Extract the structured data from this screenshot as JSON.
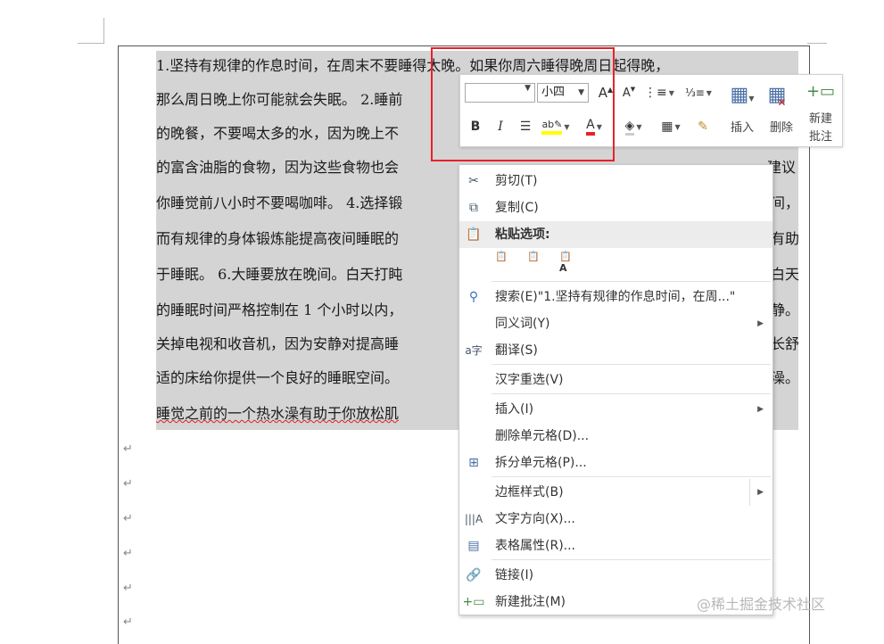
{
  "document": {
    "lines": [
      "1.坚持有规律的作息时间，在周末不要睡得太晚。如果你周六睡得晚周日起得晚，",
      "那么周日晚上你可能就会失眠。 2.睡前",
      "的晚餐，不要喝太多的水，因为晚上不",
      "的富含油脂的食物，因为这些食物也会",
      "你睡觉前八小时不要喝咖啡。 4.选择锻",
      "而有规律的身体锻炼能提高夜间睡眠的",
      "于睡眠。 6.大睡要放在晚间。白天打盹",
      "的睡眠时间严格控制在 1 个小时以内，",
      "关掉电视和收音机，因为安静对提高睡",
      "适的床给你提供一个良好的睡眠空间。",
      "睡觉之前的一个热水澡有助于你放松肌"
    ],
    "right_fragments": [
      "",
      "",
      "",
      "建议",
      "间，",
      "有助",
      "白天",
      "静。",
      "长舒",
      "澡。",
      ""
    ],
    "paragraph_mark": "↵"
  },
  "mini_toolbar": {
    "font_value": "",
    "size_value": "小四",
    "grow_font": "A",
    "shrink_font": "A",
    "bold": "B",
    "italic": "I",
    "font_color": "A",
    "insert_label": "插入",
    "delete_label": "删除",
    "comment_label_1": "新建",
    "comment_label_2": "批注"
  },
  "context_menu": {
    "cut": "剪切(T)",
    "copy": "复制(C)",
    "paste_header": "粘贴选项:",
    "search": "搜索(E)\"1.坚持有规律的作息时间，在周...\"",
    "synonyms": "同义词(Y)",
    "translate": "翻译(S)",
    "reconvert": "汉字重选(V)",
    "insert": "插入(I)",
    "delete_cells": "删除单元格(D)...",
    "split_cells": "拆分单元格(P)...",
    "border_styles": "边框样式(B)",
    "text_direction": "文字方向(X)...",
    "table_properties": "表格属性(R)...",
    "link": "链接(I)",
    "new_comment": "新建批注(M)"
  },
  "watermark": "@稀土掘金技术社区",
  "colors": {
    "selection": "#d4d4d4",
    "highlight_red": "#e8212a",
    "text_highlight": "#ffff00",
    "font_color": "#e8212a"
  }
}
